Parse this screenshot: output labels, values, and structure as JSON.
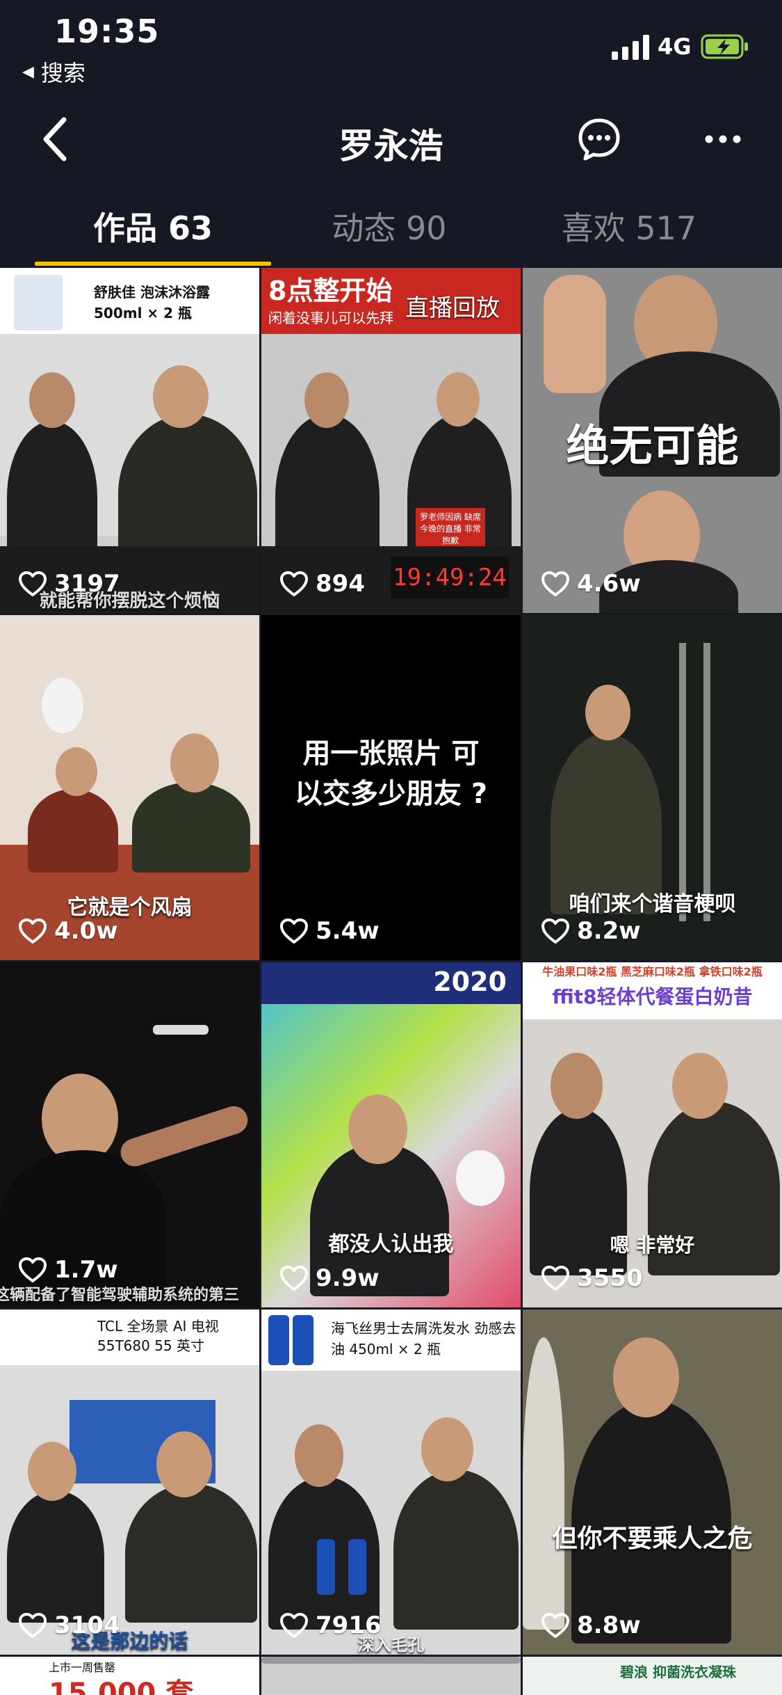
{
  "status": {
    "time": "19:35",
    "back_app": "搜索",
    "network": "4G"
  },
  "header": {
    "title": "罗永浩"
  },
  "tabs": [
    {
      "label": "作品 63"
    },
    {
      "label": "动态 90"
    },
    {
      "label": "喜欢 517"
    }
  ],
  "colors": {
    "accent": "#f2c200",
    "background": "#161823",
    "tab_inactive": "#8a8b91"
  },
  "icons": {
    "back": "chevron-left-icon",
    "message": "message-bubble-icon",
    "more": "more-dots-icon",
    "heart": "heart-outline-icon"
  },
  "videos": [
    {
      "likes": "3197",
      "caption": "就能帮你摆脱这个烦恼",
      "banner": "舒肤佳 泡沫沐浴露 500ml × 2 瓶"
    },
    {
      "likes": "894",
      "caption": "",
      "banner": "8点整开始",
      "subtitle": "闲着没事儿可以先拜",
      "badge": "直播回放",
      "clock": "19:49:24",
      "sign": "罗老师因病 缺席今晚的直播 非常抱歉"
    },
    {
      "likes": "4.6w",
      "caption": "绝无可能"
    },
    {
      "likes": "4.0w",
      "caption": "它就是个风扇"
    },
    {
      "likes": "5.4w",
      "caption": "用一张照片 可以交多少朋友 ?"
    },
    {
      "likes": "8.2w",
      "caption": "咱们来个谐音梗呗"
    },
    {
      "likes": "1.7w",
      "caption": "这辆配备了智能驾驶辅助系统的第三"
    },
    {
      "likes": "9.9w",
      "caption": "都没人认出我",
      "banner": "2020"
    },
    {
      "likes": "3550",
      "caption": "嗯 非常好",
      "banner": "ffit8轻体代餐蛋白奶昔",
      "subtitle": "牛油果口味2瓶 黑芝麻口味2瓶 拿铁口味2瓶"
    },
    {
      "likes": "3104",
      "caption": "这是那边的话",
      "banner": "TCL 全场景 AI 电视 55T680 55 英寸"
    },
    {
      "likes": "7916",
      "caption": "深入毛孔",
      "banner": "海飞丝男士去屑洗发水 劲感去油 450ml × 2 瓶"
    },
    {
      "likes": "8.8w",
      "caption": "但你不要乘人之危"
    }
  ],
  "partial_row": [
    {
      "banner": "上市一周售罄",
      "text": "15,000 套"
    },
    {
      "text": ""
    },
    {
      "banner": "碧浪 抑菌洗衣凝珠"
    }
  ]
}
